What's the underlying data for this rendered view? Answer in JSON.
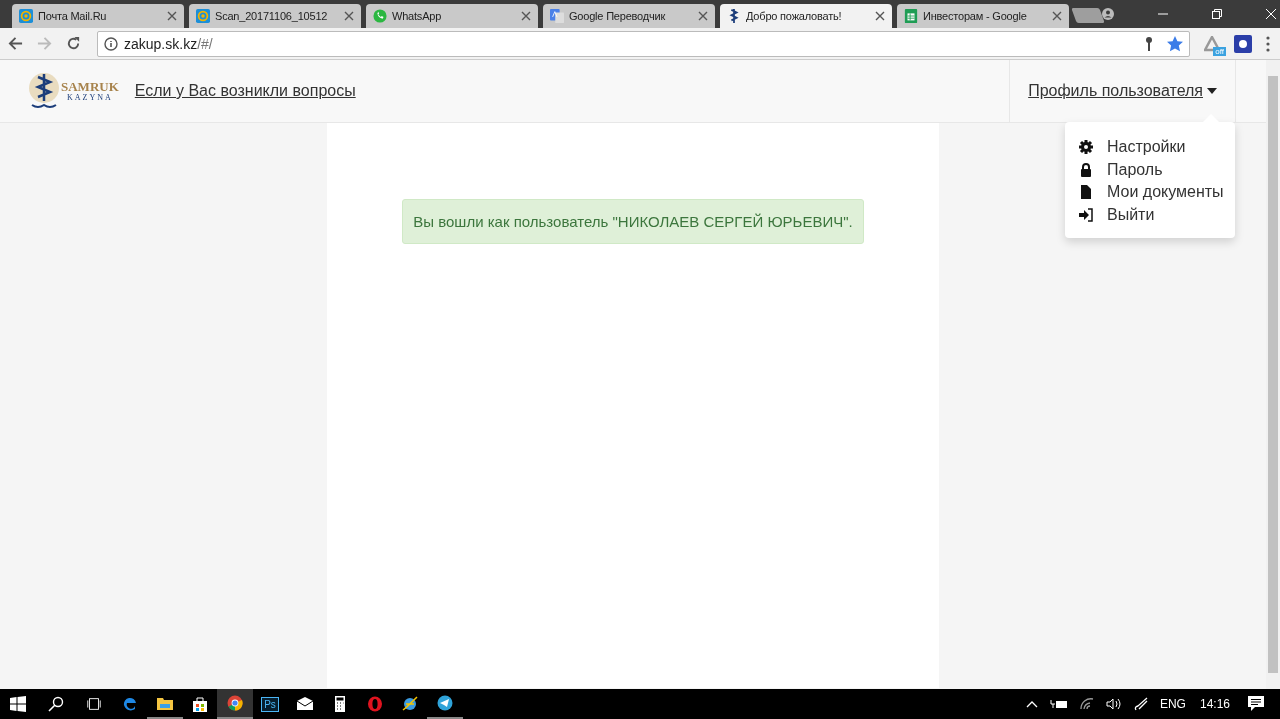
{
  "browser": {
    "tabs": [
      {
        "title": "Почта Mail.Ru",
        "kind": "mail",
        "selected": false
      },
      {
        "title": "Scan_20171106_10512",
        "kind": "mail",
        "selected": false
      },
      {
        "title": "WhatsApp",
        "kind": "whatsapp",
        "selected": false
      },
      {
        "title": "Google Переводчик",
        "kind": "translate",
        "selected": false
      },
      {
        "title": "Добро пожаловать!",
        "kind": "samruk",
        "selected": true
      },
      {
        "title": "Инвесторам - Google",
        "kind": "sheets",
        "selected": false
      }
    ],
    "address": {
      "host": "zakup.sk.kz",
      "path": "/#/"
    },
    "extension_badge": "off"
  },
  "header": {
    "logo": {
      "name": "SAMRUK",
      "subtitle": "KAZYNA"
    },
    "help_link": "Если у Вас возникли вопросы",
    "profile_menu": {
      "label": "Профиль пользователя",
      "expanded": true,
      "items": [
        {
          "label": "Настройки",
          "kind": "gear"
        },
        {
          "label": "Пароль",
          "kind": "lock"
        },
        {
          "label": "Мои документы",
          "kind": "file"
        },
        {
          "label": "Выйти",
          "kind": "signin"
        }
      ]
    }
  },
  "alert": "Вы вошли как пользователь \"НИКОЛАЕВ СЕРГЕЙ ЮРЬЕВИЧ\".",
  "taskbar": {
    "apps": [
      {
        "kind": "edge",
        "running": false,
        "active": false
      },
      {
        "kind": "folder",
        "running": true,
        "active": false
      },
      {
        "kind": "store",
        "running": false,
        "active": false
      },
      {
        "kind": "chrome",
        "running": true,
        "active": true
      },
      {
        "kind": "photoshop",
        "label": "Ps",
        "running": false,
        "active": false
      },
      {
        "kind": "mail",
        "running": false,
        "active": false
      },
      {
        "kind": "calculator",
        "running": false,
        "active": false
      },
      {
        "kind": "opera",
        "running": false,
        "active": false
      },
      {
        "kind": "ie",
        "running": false,
        "active": false
      },
      {
        "kind": "telegram",
        "running": true,
        "active": false
      }
    ],
    "language": "ENG",
    "time": "14:16"
  }
}
